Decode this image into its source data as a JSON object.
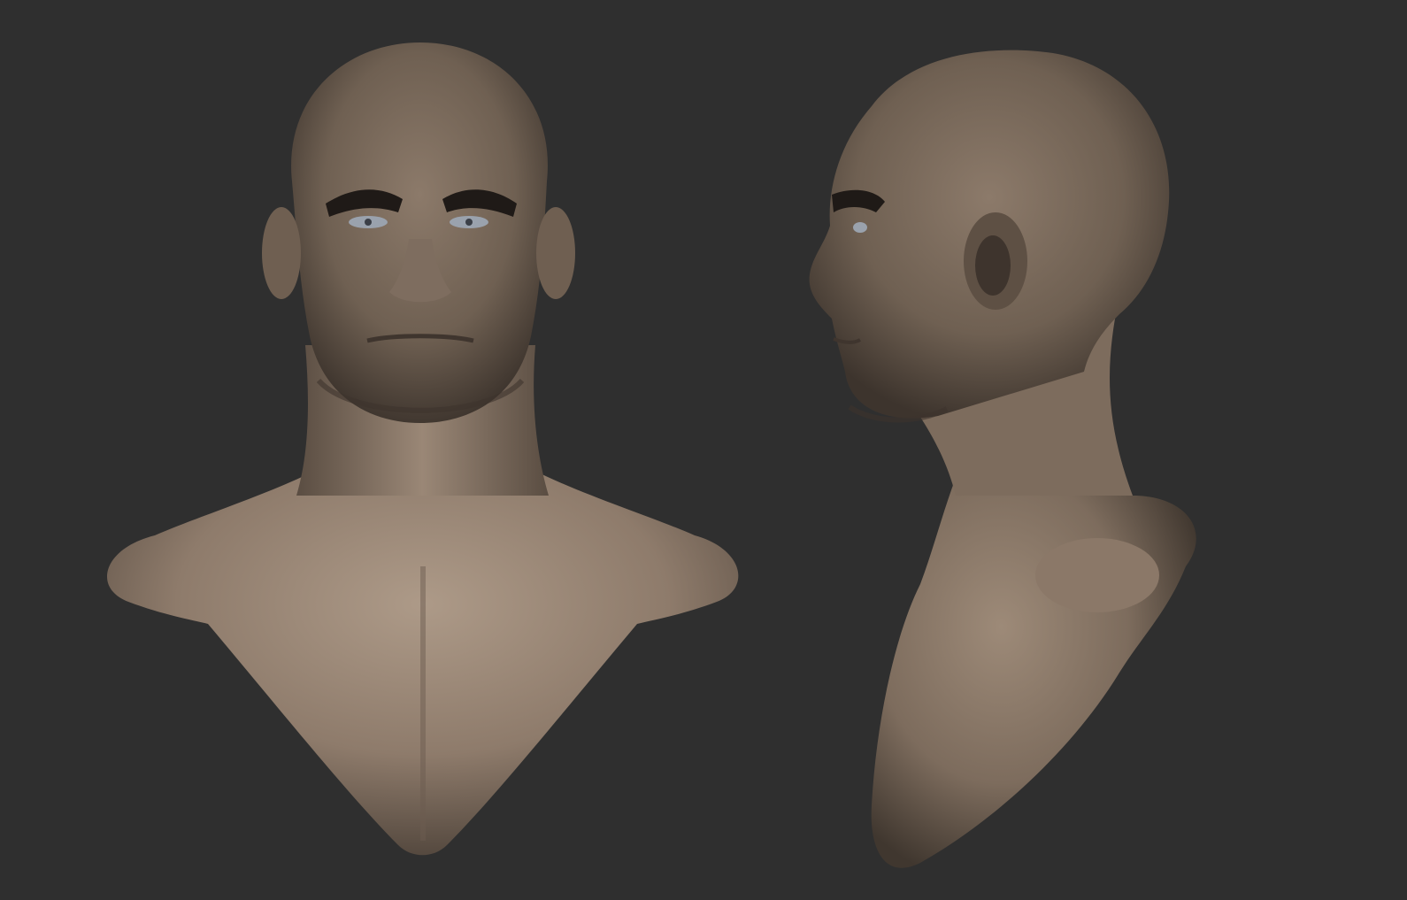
{
  "scene": {
    "background_color": "#2f2f2f",
    "material_color": "#8d7a69",
    "views": [
      {
        "name": "front-view"
      },
      {
        "name": "side-view"
      }
    ]
  }
}
